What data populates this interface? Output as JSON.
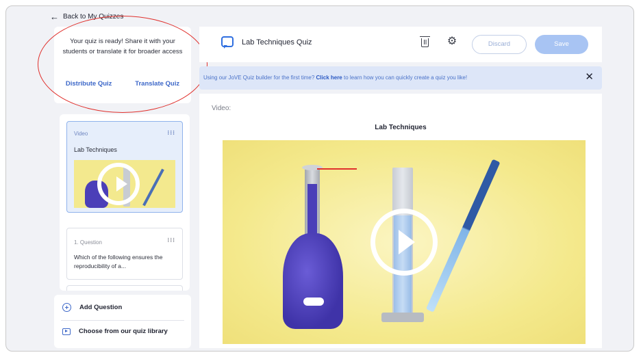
{
  "nav": {
    "back_label": "Back to My Quizzes"
  },
  "share": {
    "message": "Your quiz is ready! Share it with your students or translate it for broader access",
    "distribute_label": "Distribute Quiz",
    "translate_label": "Translate Quiz"
  },
  "sidebar": {
    "items": [
      {
        "type": "Video",
        "title": "Lab Techniques"
      },
      {
        "type": "1. Question",
        "title": "Which of the following ensures the reproducibility of a..."
      }
    ],
    "add_question_label": "Add Question",
    "library_label": "Choose from our quiz library"
  },
  "header": {
    "title": "Lab Techniques Quiz",
    "discard_label": "Discard",
    "save_label": "Save"
  },
  "banner": {
    "pre": "Using our JoVE Quiz builder for the first time? ",
    "link": "Click here",
    "post": " to learn how you can quickly create a quiz you like!",
    "close": "✕"
  },
  "content": {
    "section_label": "Video:",
    "video_title": "Lab Techniques"
  },
  "colors": {
    "accent": "#2f6fe0",
    "annotation": "#e0302c",
    "banner_bg": "#dde6f8"
  }
}
